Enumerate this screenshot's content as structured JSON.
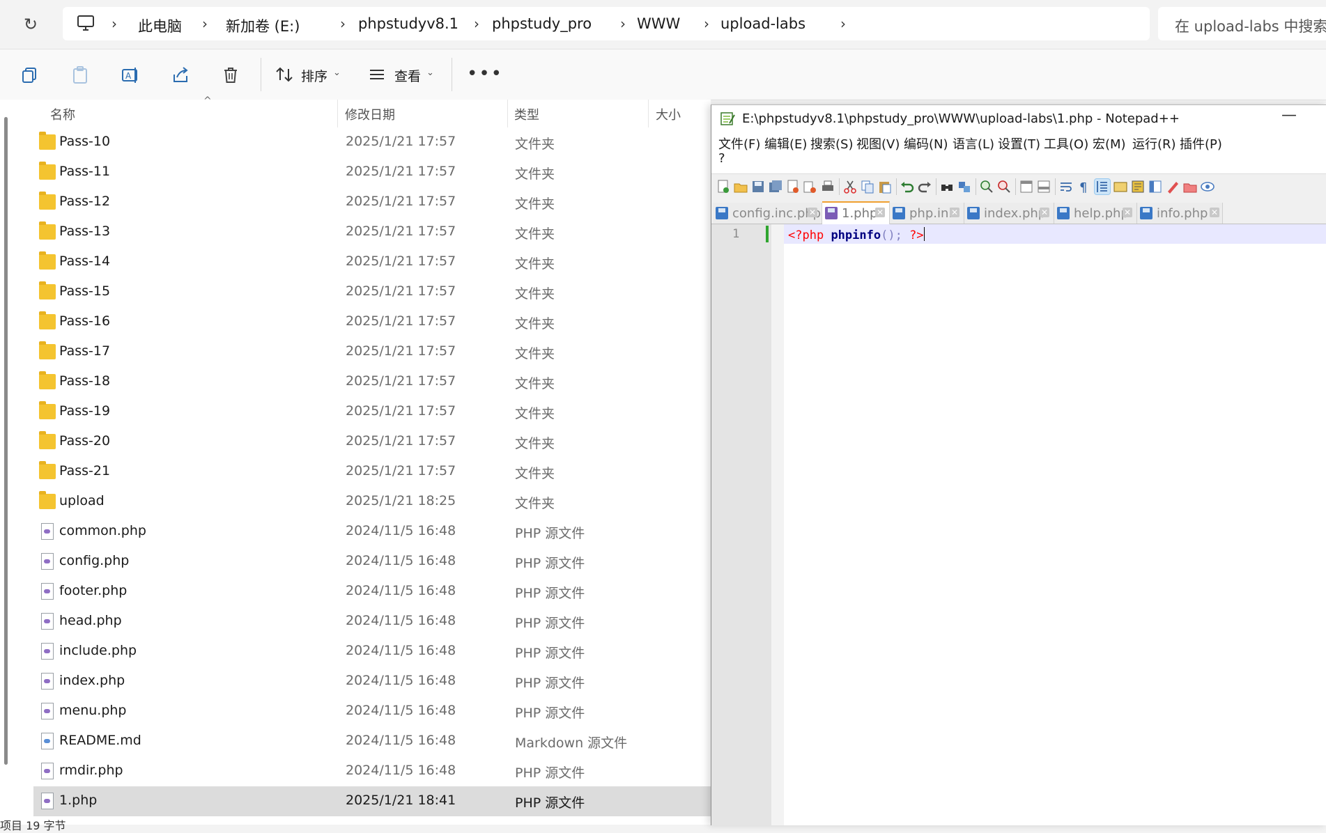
{
  "explorer": {
    "breadcrumb": [
      "此电脑",
      "新加卷 (E:)",
      "phpstudyv8.1",
      "phpstudy_pro",
      "WWW",
      "upload-labs"
    ],
    "search_placeholder": "在 upload-labs 中搜索",
    "toolbar": {
      "sort_label": "排序",
      "view_label": "查看"
    },
    "columns": {
      "name": "名称",
      "date": "修改日期",
      "type": "类型",
      "size": "大小"
    },
    "files": [
      {
        "name": "Pass-10",
        "date": "2025/1/21 17:57",
        "type": "文件夹",
        "icon": "folder-icon"
      },
      {
        "name": "Pass-11",
        "date": "2025/1/21 17:57",
        "type": "文件夹",
        "icon": "folder-icon"
      },
      {
        "name": "Pass-12",
        "date": "2025/1/21 17:57",
        "type": "文件夹",
        "icon": "folder-icon"
      },
      {
        "name": "Pass-13",
        "date": "2025/1/21 17:57",
        "type": "文件夹",
        "icon": "folder-icon"
      },
      {
        "name": "Pass-14",
        "date": "2025/1/21 17:57",
        "type": "文件夹",
        "icon": "folder-icon"
      },
      {
        "name": "Pass-15",
        "date": "2025/1/21 17:57",
        "type": "文件夹",
        "icon": "folder-icon"
      },
      {
        "name": "Pass-16",
        "date": "2025/1/21 17:57",
        "type": "文件夹",
        "icon": "folder-icon"
      },
      {
        "name": "Pass-17",
        "date": "2025/1/21 17:57",
        "type": "文件夹",
        "icon": "folder-icon"
      },
      {
        "name": "Pass-18",
        "date": "2025/1/21 17:57",
        "type": "文件夹",
        "icon": "folder-icon"
      },
      {
        "name": "Pass-19",
        "date": "2025/1/21 17:57",
        "type": "文件夹",
        "icon": "folder-icon"
      },
      {
        "name": "Pass-20",
        "date": "2025/1/21 17:57",
        "type": "文件夹",
        "icon": "folder-icon"
      },
      {
        "name": "Pass-21",
        "date": "2025/1/21 17:57",
        "type": "文件夹",
        "icon": "folder-icon"
      },
      {
        "name": "upload",
        "date": "2025/1/21 18:25",
        "type": "文件夹",
        "icon": "folder-icon"
      },
      {
        "name": "common.php",
        "date": "2024/11/5 16:48",
        "type": "PHP 源文件",
        "icon": "php-file-icon"
      },
      {
        "name": "config.php",
        "date": "2024/11/5 16:48",
        "type": "PHP 源文件",
        "icon": "php-file-icon"
      },
      {
        "name": "footer.php",
        "date": "2024/11/5 16:48",
        "type": "PHP 源文件",
        "icon": "php-file-icon"
      },
      {
        "name": "head.php",
        "date": "2024/11/5 16:48",
        "type": "PHP 源文件",
        "icon": "php-file-icon"
      },
      {
        "name": "include.php",
        "date": "2024/11/5 16:48",
        "type": "PHP 源文件",
        "icon": "php-file-icon"
      },
      {
        "name": "index.php",
        "date": "2024/11/5 16:48",
        "type": "PHP 源文件",
        "icon": "php-file-icon"
      },
      {
        "name": "menu.php",
        "date": "2024/11/5 16:48",
        "type": "PHP 源文件",
        "icon": "php-file-icon"
      },
      {
        "name": "README.md",
        "date": "2024/11/5 16:48",
        "type": "Markdown 源文件",
        "icon": "markdown-file-icon"
      },
      {
        "name": "rmdir.php",
        "date": "2024/11/5 16:48",
        "type": "PHP 源文件",
        "icon": "php-file-icon"
      },
      {
        "name": "1.php",
        "date": "2025/1/21 18:41",
        "type": "PHP 源文件",
        "icon": "php-file-icon",
        "selected": true
      }
    ],
    "status_text": "项目 19 字节"
  },
  "notepad": {
    "title": "E:\\phpstudyv8.1\\phpstudy_pro\\WWW\\upload-labs\\1.php - Notepad++",
    "minimize": "—",
    "menu": [
      "文件(F)",
      "编辑(E)",
      "搜索(S)",
      "视图(V)",
      "编码(N)",
      "语言(L)",
      "设置(T)",
      "工具(O)",
      "宏(M)",
      "运行(R)",
      "插件(P)",
      "?"
    ],
    "tabs": [
      {
        "label": "config.inc.php",
        "active": false
      },
      {
        "label": "1.php",
        "active": true
      },
      {
        "label": "php.ini",
        "active": false
      },
      {
        "label": "index.php",
        "active": false
      },
      {
        "label": "help.php",
        "active": false
      },
      {
        "label": "info.php",
        "active": false
      }
    ],
    "tab_close": "✕",
    "line_number": "1",
    "code": {
      "open_tag": "<?php",
      "function": "phpinfo",
      "punct": "();",
      "close_tag": "?>"
    }
  }
}
